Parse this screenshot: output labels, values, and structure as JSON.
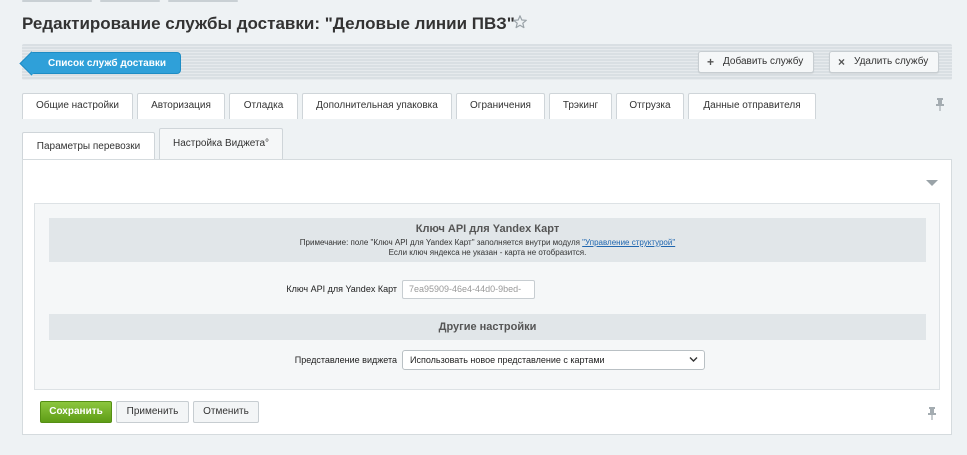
{
  "title": "Редактирование службы доставки: \"Деловые линии ПВЗ\"",
  "toolbar": {
    "back_label": "Список служб доставки",
    "add_label": "Добавить службу",
    "delete_label": "Удалить службу"
  },
  "tabs": [
    "Общие настройки",
    "Авторизация",
    "Отладка",
    "Дополнительная упаковка",
    "Ограничения",
    "Трэкинг",
    "Отгрузка",
    "Данные отправителя"
  ],
  "subtabs": [
    "Параметры перевозки",
    "Настройка Виджета°"
  ],
  "section_yandex": {
    "title": "Ключ API для Yandex Карт",
    "note_prefix": "Примечание: поле \"Ключ API для Yandex Карт\" заполняется внутри модуля ",
    "note_link": "\"Управление структурой\"",
    "note_line2": "Если ключ яндекса не указан - карта не отобразится."
  },
  "api_key": {
    "label": "Ключ API для Yandex Карт",
    "value": "7ea95909-46e4-44d0-9bed-"
  },
  "section_other": {
    "title": "Другие настройки"
  },
  "widget_view": {
    "label": "Представление виджета",
    "selected": "Использовать новое представление с картами"
  },
  "buttons": {
    "save": "Сохранить",
    "apply": "Применить",
    "cancel": "Отменить"
  },
  "colors": {
    "accent_blue": "#2fa0d9",
    "save_green": "#6cab1e",
    "link": "#2067b0"
  }
}
